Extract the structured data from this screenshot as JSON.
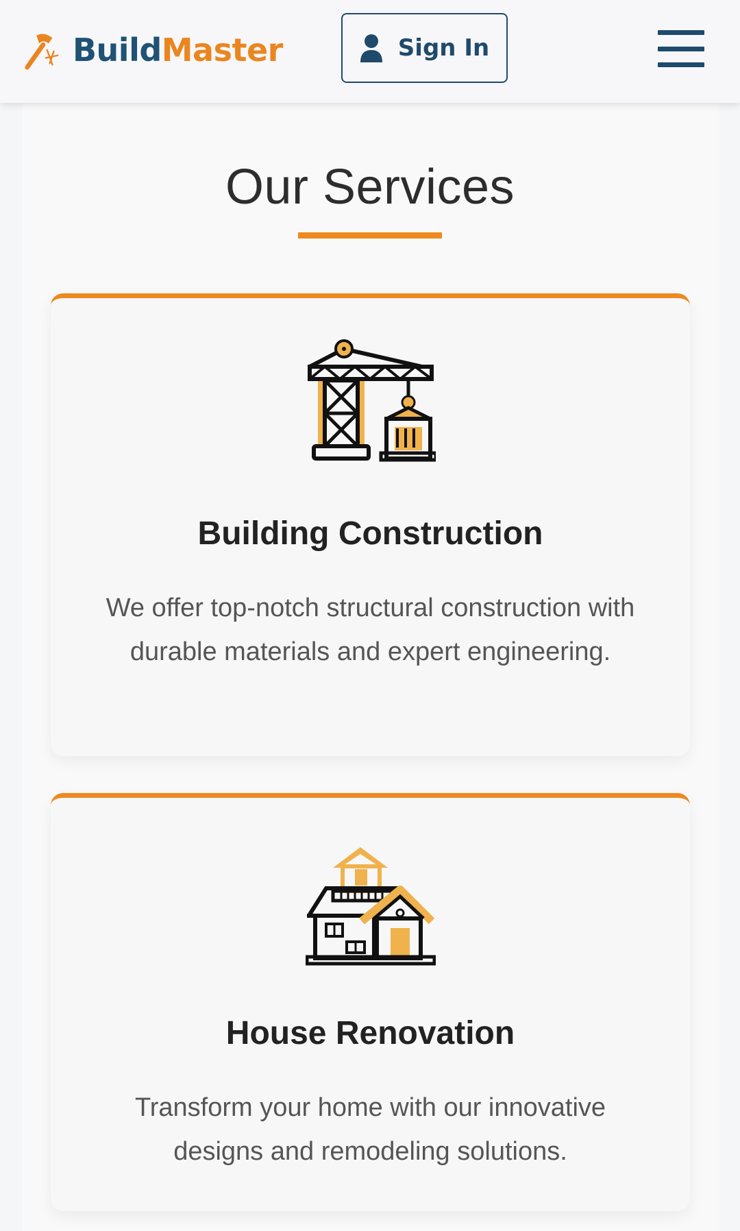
{
  "header": {
    "brand_part1": "Build",
    "brand_part2": "Master",
    "logo_icon": "hammer-icon",
    "signin_label": "Sign In",
    "signin_icon": "user-icon",
    "menu_icon": "hamburger-menu-icon"
  },
  "services": {
    "title": "Our Services",
    "items": [
      {
        "icon": "crane-icon",
        "title": "Building Construction",
        "description": "We offer top-notch structural construction with durable materials and expert engineering."
      },
      {
        "icon": "house-renovation-icon",
        "title": "House Renovation",
        "description": "Transform your home with our innovative designs and remodeling solutions."
      }
    ]
  },
  "colors": {
    "brand_blue": "#1f5274",
    "accent_orange": "#ea8620",
    "icon_yellow": "#f0b24d"
  }
}
